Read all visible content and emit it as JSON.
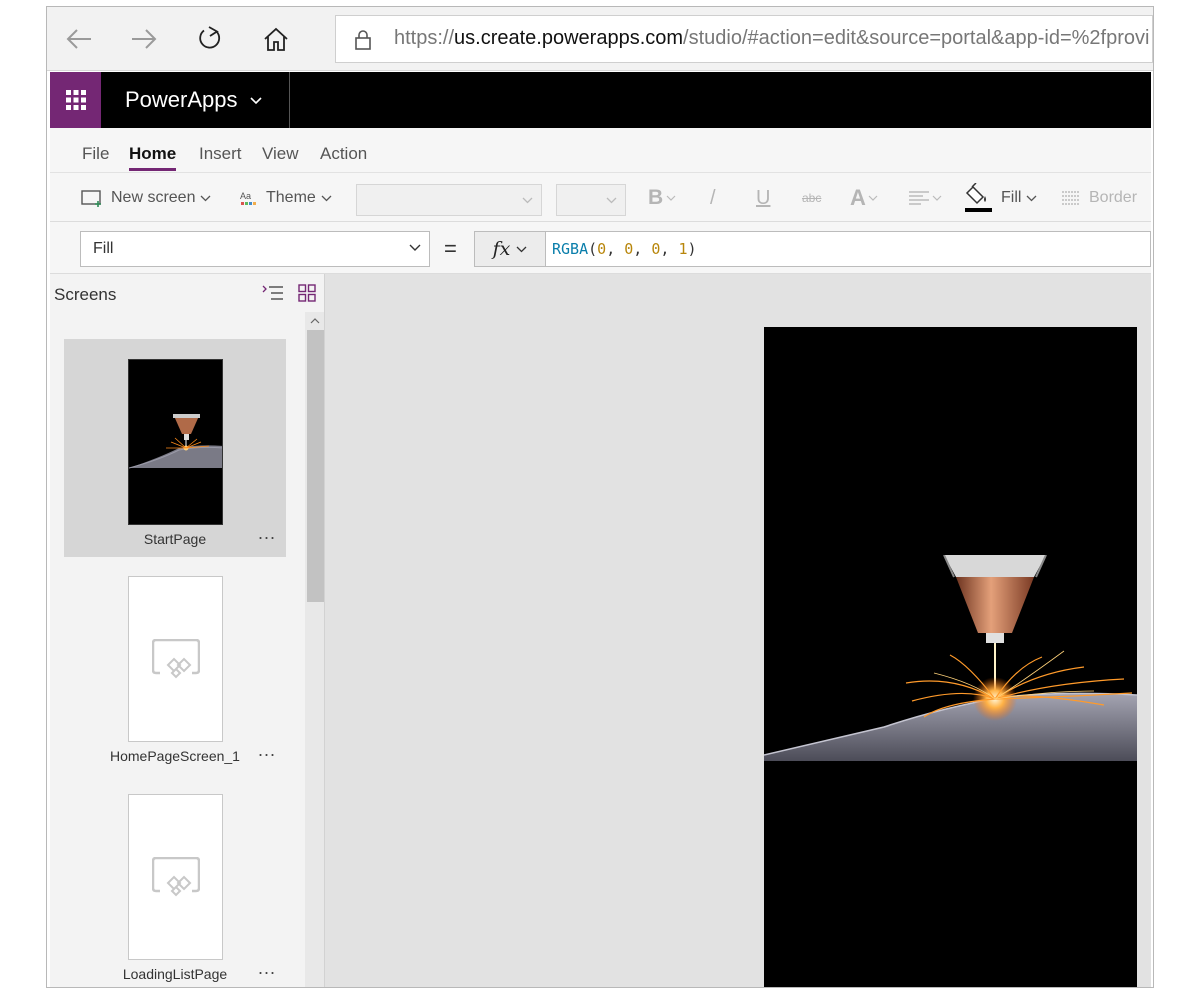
{
  "browser": {
    "url_scheme": "https://",
    "url_domain": "us.create.powerapps.com",
    "url_path": "/studio/#action=edit&source=portal&app-id=%2fprovi",
    "icons": [
      "back-icon",
      "forward-icon",
      "refresh-icon",
      "home-icon",
      "lock-icon"
    ]
  },
  "app": {
    "name": "PowerApps",
    "brand_color": "#742774"
  },
  "ribbon": {
    "tabs": [
      {
        "label": "File"
      },
      {
        "label": "Home",
        "active": true
      },
      {
        "label": "Insert"
      },
      {
        "label": "View"
      },
      {
        "label": "Action"
      }
    ]
  },
  "toolbar": {
    "new_screen": "New screen",
    "theme": "Theme",
    "bold": "B",
    "italic": "/",
    "underline": "U",
    "strike": "abc",
    "font_color": "A",
    "fill": "Fill",
    "border": "Border"
  },
  "formula": {
    "property": "Fill",
    "equals": "=",
    "fx_label": "fx",
    "fn": "RGBA",
    "args": [
      "0",
      "0",
      "0",
      "1"
    ]
  },
  "screens": {
    "title": "Screens",
    "items": [
      {
        "name": "StartPage",
        "selected": true,
        "thumbnail": "laser-image"
      },
      {
        "name": "HomePageScreen_1",
        "selected": false,
        "thumbnail": "placeholder"
      },
      {
        "name": "LoadingListPage",
        "selected": false,
        "thumbnail": "placeholder"
      }
    ],
    "more_label": "..."
  },
  "canvas": {
    "screen_fill": "#000000",
    "image": "laser-cutting-sparks"
  }
}
